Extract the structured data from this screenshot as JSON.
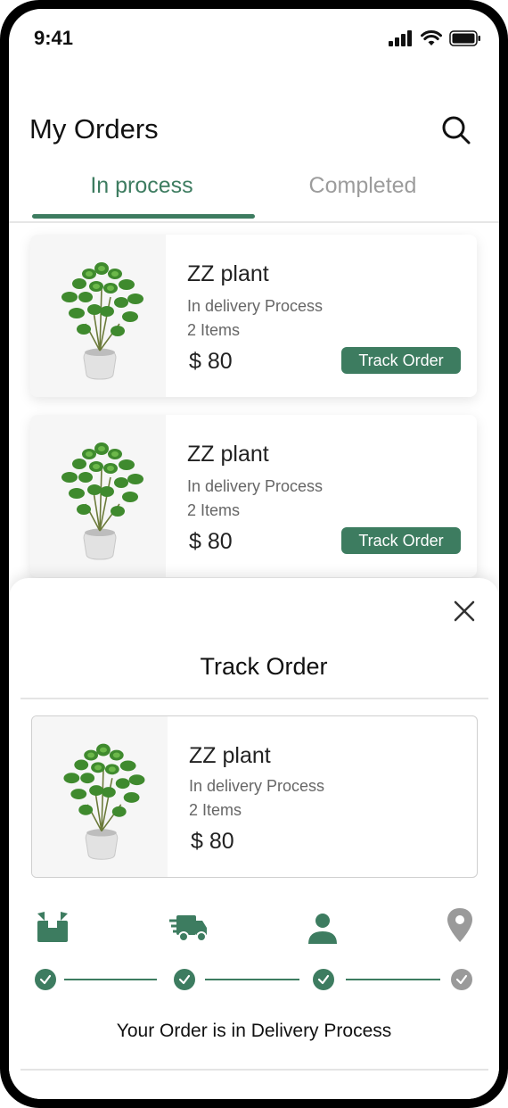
{
  "status_bar": {
    "time": "9:41"
  },
  "header": {
    "title": "My Orders"
  },
  "tabs": [
    {
      "label": "In process",
      "active": true
    },
    {
      "label": "Completed",
      "active": false
    }
  ],
  "orders": [
    {
      "name": "ZZ plant",
      "status": "In delivery Process",
      "items": "2 Items",
      "price": "$ 80",
      "action": "Track Order"
    },
    {
      "name": "ZZ plant",
      "status": "In delivery Process",
      "items": "2 Items",
      "price": "$ 80",
      "action": "Track Order"
    }
  ],
  "track_sheet": {
    "title": "Track Order",
    "order": {
      "name": "ZZ plant",
      "status": "In delivery Process",
      "items": "2 Items",
      "price": "$ 80"
    },
    "steps": [
      {
        "icon": "package-icon",
        "done": true
      },
      {
        "icon": "delivery-truck-icon",
        "done": true
      },
      {
        "icon": "person-icon",
        "done": true
      },
      {
        "icon": "location-pin-icon",
        "done": false
      }
    ],
    "message": "Your Order is in Delivery Process"
  },
  "colors": {
    "accent": "#3d7c60",
    "pending": "#9a9a9a",
    "muted_text": "#9c9c9c"
  }
}
